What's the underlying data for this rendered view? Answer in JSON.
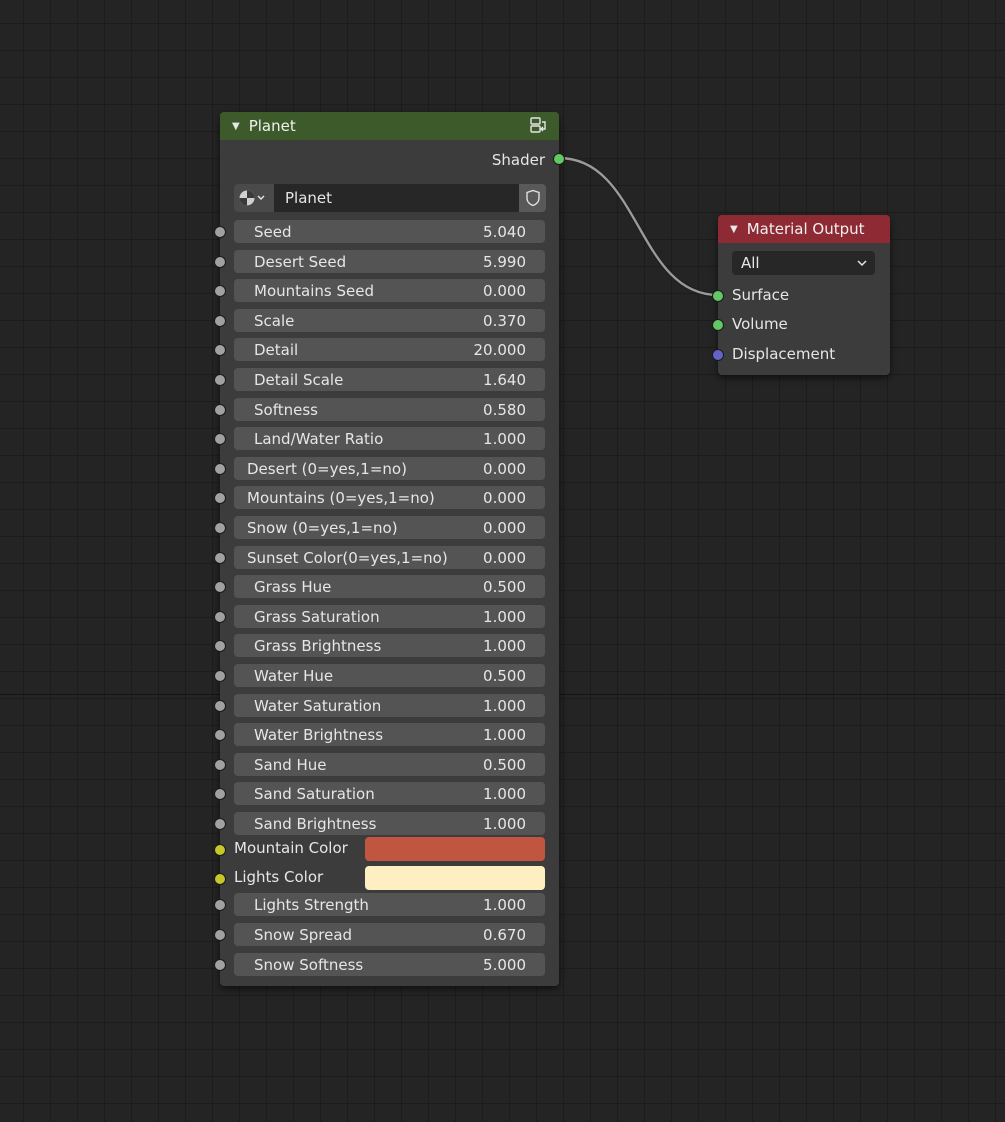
{
  "planet_node": {
    "title": "Planet",
    "output_label": "Shader",
    "material_name": "Planet",
    "fields": [
      {
        "label": "Seed",
        "value": "5.040"
      },
      {
        "label": "Desert Seed",
        "value": "5.990"
      },
      {
        "label": "Mountains Seed",
        "value": "0.000"
      },
      {
        "label": "Scale",
        "value": "0.370"
      },
      {
        "label": "Detail",
        "value": "20.000"
      },
      {
        "label": "Detail Scale",
        "value": "1.640"
      },
      {
        "label": "Softness",
        "value": "0.580"
      },
      {
        "label": "Land/Water Ratio",
        "value": "1.000"
      },
      {
        "label": "Desert (0=yes,1=no)",
        "value": "0.000"
      },
      {
        "label": "Mountains (0=yes,1=no)",
        "value": "0.000"
      },
      {
        "label": "Snow (0=yes,1=no)",
        "value": "0.000"
      },
      {
        "label": "Sunset Color(0=yes,1=no)",
        "value": "0.000"
      },
      {
        "label": "Grass Hue",
        "value": "0.500"
      },
      {
        "label": "Grass Saturation",
        "value": "1.000"
      },
      {
        "label": "Grass Brightness",
        "value": "1.000"
      },
      {
        "label": "Water Hue",
        "value": "0.500"
      },
      {
        "label": "Water Saturation",
        "value": "1.000"
      },
      {
        "label": "Water Brightness",
        "value": "1.000"
      },
      {
        "label": "Sand Hue",
        "value": "0.500"
      },
      {
        "label": "Sand Saturation",
        "value": "1.000"
      },
      {
        "label": "Sand Brightness",
        "value": "1.000"
      }
    ],
    "colors": [
      {
        "label": "Mountain Color",
        "color": "#c05640"
      },
      {
        "label": "Lights Color",
        "color": "#fdefc2"
      }
    ],
    "fields_bottom": [
      {
        "label": "Lights Strength",
        "value": "1.000"
      },
      {
        "label": "Snow Spread",
        "value": "0.670"
      },
      {
        "label": "Snow Softness",
        "value": "5.000"
      }
    ]
  },
  "output_node": {
    "title": "Material Output",
    "target": "All",
    "inputs": [
      "Surface",
      "Volume",
      "Displacement"
    ]
  },
  "colors": {
    "planet_header": "#3d5a2a",
    "output_header": "#8e2a33",
    "shader_socket": "#63c763",
    "value_socket": "#a1a1a1",
    "color_socket": "#c7c729",
    "vector_socket": "#6363c7"
  }
}
